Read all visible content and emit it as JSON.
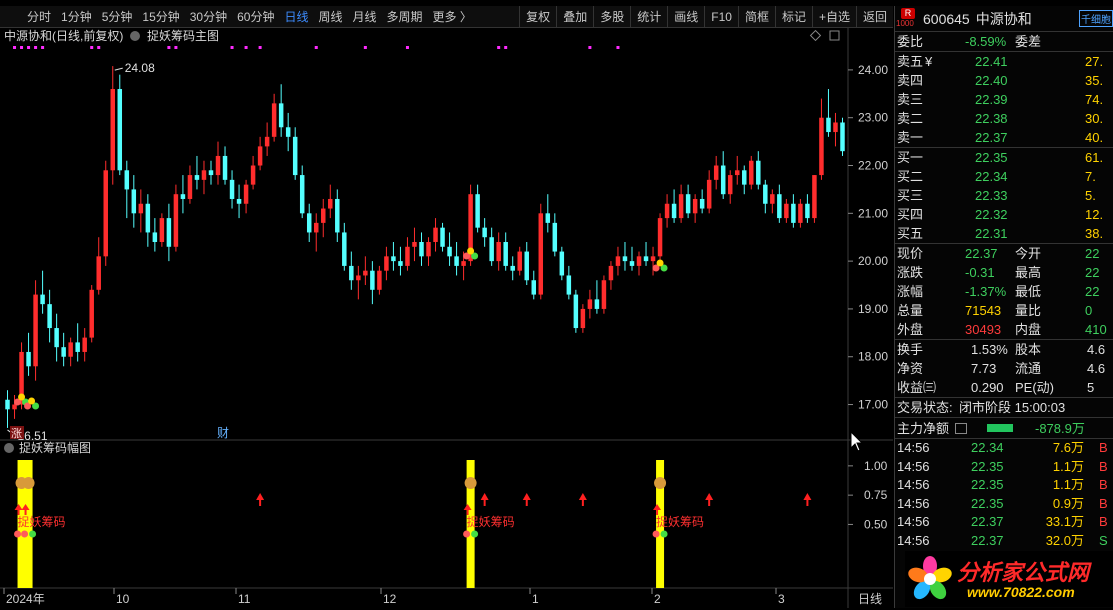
{
  "toolbar": {
    "periods": [
      "分时",
      "1分钟",
      "5分钟",
      "15分钟",
      "30分钟",
      "60分钟",
      "日线",
      "周线",
      "月线",
      "多周期",
      "更多 〉"
    ],
    "active_period": "日线",
    "right_buttons": [
      "复权",
      "叠加",
      "多股",
      "统计",
      "画线",
      "F10",
      "简框",
      "标记",
      "+自选",
      "返回"
    ]
  },
  "main_chart": {
    "title": "中源协和(日线,前复权)",
    "indicator": "捉妖筹码主图",
    "high_label": "24.08",
    "low_label": "16.51",
    "y_ticks": [
      "24.00",
      "23.00",
      "22.00",
      "21.00",
      "20.00",
      "19.00",
      "18.00",
      "17.00"
    ],
    "zhang_badge": "涨",
    "cai_badge": "财"
  },
  "sub_chart": {
    "title": "捉妖筹码幅图",
    "y_ticks": [
      "1.00",
      "0.75",
      "0.50"
    ],
    "signal_label": "捉妖筹码"
  },
  "x_axis": {
    "labels": [
      "2024年",
      "10",
      "11",
      "12",
      "1",
      "2",
      "3"
    ],
    "period_label": "日线"
  },
  "chart_data": {
    "type": "candlestick",
    "title": "中源协和(日线,前复权)",
    "ylim": [
      16.3,
      24.5
    ],
    "candles": [
      [
        17.1,
        17.3,
        16.51,
        16.9
      ],
      [
        16.9,
        17.2,
        16.7,
        17.0
      ],
      [
        17.0,
        18.3,
        16.9,
        18.1
      ],
      [
        18.1,
        18.5,
        17.6,
        17.8
      ],
      [
        17.8,
        19.6,
        17.5,
        19.3
      ],
      [
        19.3,
        19.8,
        18.9,
        19.1
      ],
      [
        19.1,
        19.4,
        18.3,
        18.6
      ],
      [
        18.6,
        18.9,
        17.9,
        18.2
      ],
      [
        18.2,
        18.5,
        17.8,
        18.0
      ],
      [
        18.0,
        18.4,
        17.8,
        18.3
      ],
      [
        18.3,
        18.7,
        17.9,
        18.1
      ],
      [
        18.1,
        18.6,
        17.9,
        18.4
      ],
      [
        18.4,
        19.5,
        18.3,
        19.4
      ],
      [
        19.4,
        20.5,
        19.3,
        20.1
      ],
      [
        20.1,
        22.1,
        19.9,
        21.9
      ],
      [
        21.9,
        24.08,
        21.6,
        23.6
      ],
      [
        23.6,
        23.9,
        21.8,
        21.9
      ],
      [
        21.9,
        22.1,
        20.9,
        21.5
      ],
      [
        21.5,
        21.8,
        20.7,
        21.0
      ],
      [
        21.0,
        21.5,
        20.6,
        21.2
      ],
      [
        21.2,
        21.4,
        20.3,
        20.6
      ],
      [
        20.6,
        20.9,
        20.2,
        20.4
      ],
      [
        20.4,
        21.0,
        20.3,
        20.9
      ],
      [
        20.9,
        21.2,
        20.0,
        20.3
      ],
      [
        20.3,
        21.6,
        20.2,
        21.4
      ],
      [
        21.4,
        21.8,
        21.0,
        21.3
      ],
      [
        21.3,
        22.0,
        21.2,
        21.8
      ],
      [
        21.8,
        22.2,
        21.5,
        21.7
      ],
      [
        21.7,
        22.1,
        21.4,
        21.9
      ],
      [
        21.9,
        22.1,
        21.6,
        21.8
      ],
      [
        21.8,
        22.5,
        21.6,
        22.2
      ],
      [
        22.2,
        22.4,
        21.6,
        21.7
      ],
      [
        21.7,
        21.9,
        21.1,
        21.3
      ],
      [
        21.3,
        21.6,
        20.9,
        21.2
      ],
      [
        21.2,
        21.7,
        21.0,
        21.6
      ],
      [
        21.6,
        22.2,
        21.5,
        22.0
      ],
      [
        22.0,
        22.6,
        21.9,
        22.4
      ],
      [
        22.4,
        22.9,
        22.2,
        22.6
      ],
      [
        22.6,
        23.5,
        22.5,
        23.3
      ],
      [
        23.3,
        23.7,
        22.6,
        22.8
      ],
      [
        22.8,
        23.1,
        22.3,
        22.6
      ],
      [
        22.6,
        22.8,
        21.7,
        21.8
      ],
      [
        21.8,
        22.0,
        20.9,
        21.0
      ],
      [
        21.0,
        21.2,
        20.4,
        20.6
      ],
      [
        20.6,
        21.0,
        20.2,
        20.8
      ],
      [
        20.8,
        21.3,
        20.5,
        21.1
      ],
      [
        21.1,
        21.6,
        20.9,
        21.3
      ],
      [
        21.3,
        21.5,
        20.4,
        20.6
      ],
      [
        20.6,
        20.8,
        19.8,
        19.9
      ],
      [
        19.9,
        20.2,
        19.4,
        19.6
      ],
      [
        19.6,
        19.9,
        19.2,
        19.7
      ],
      [
        19.7,
        20.1,
        19.5,
        19.8
      ],
      [
        19.8,
        20.0,
        19.1,
        19.4
      ],
      [
        19.4,
        19.9,
        19.3,
        19.8
      ],
      [
        19.8,
        20.3,
        19.6,
        20.1
      ],
      [
        20.1,
        20.4,
        19.8,
        20.0
      ],
      [
        20.0,
        20.3,
        19.7,
        19.9
      ],
      [
        19.9,
        20.5,
        19.8,
        20.3
      ],
      [
        20.3,
        20.7,
        20.0,
        20.4
      ],
      [
        20.4,
        20.6,
        19.9,
        20.1
      ],
      [
        20.1,
        20.5,
        19.9,
        20.4
      ],
      [
        20.4,
        20.9,
        20.2,
        20.7
      ],
      [
        20.7,
        20.8,
        20.2,
        20.3
      ],
      [
        20.3,
        20.6,
        19.9,
        20.1
      ],
      [
        20.1,
        20.4,
        19.7,
        19.9
      ],
      [
        19.9,
        20.2,
        19.6,
        20.0
      ],
      [
        20.0,
        21.6,
        19.9,
        21.4
      ],
      [
        21.4,
        21.6,
        20.6,
        20.7
      ],
      [
        20.7,
        20.9,
        20.3,
        20.5
      ],
      [
        20.5,
        20.7,
        19.9,
        20.0
      ],
      [
        20.0,
        20.6,
        19.8,
        20.4
      ],
      [
        20.4,
        20.6,
        19.8,
        19.9
      ],
      [
        19.9,
        20.1,
        19.6,
        19.8
      ],
      [
        19.8,
        20.3,
        19.7,
        20.2
      ],
      [
        20.2,
        20.4,
        19.5,
        19.6
      ],
      [
        19.6,
        19.8,
        19.2,
        19.3
      ],
      [
        19.3,
        21.2,
        19.2,
        21.0
      ],
      [
        21.0,
        21.4,
        20.6,
        20.8
      ],
      [
        20.8,
        21.0,
        20.1,
        20.2
      ],
      [
        20.2,
        20.3,
        19.6,
        19.7
      ],
      [
        19.7,
        19.9,
        19.2,
        19.3
      ],
      [
        19.3,
        19.4,
        18.5,
        18.6
      ],
      [
        18.6,
        19.1,
        18.5,
        19.0
      ],
      [
        19.0,
        19.4,
        18.8,
        19.2
      ],
      [
        19.2,
        19.6,
        18.9,
        19.0
      ],
      [
        19.0,
        19.7,
        18.9,
        19.6
      ],
      [
        19.6,
        20.0,
        19.4,
        19.9
      ],
      [
        19.9,
        20.3,
        19.7,
        20.1
      ],
      [
        20.1,
        20.4,
        19.8,
        20.0
      ],
      [
        20.0,
        20.3,
        19.8,
        19.9
      ],
      [
        19.9,
        20.2,
        19.7,
        20.1
      ],
      [
        20.1,
        20.4,
        19.9,
        20.0
      ],
      [
        20.0,
        20.3,
        19.7,
        20.1
      ],
      [
        20.1,
        21.0,
        19.9,
        20.9
      ],
      [
        20.9,
        21.4,
        20.7,
        21.2
      ],
      [
        21.2,
        21.5,
        20.8,
        20.9
      ],
      [
        20.9,
        21.6,
        20.8,
        21.4
      ],
      [
        21.4,
        21.6,
        20.9,
        21.0
      ],
      [
        21.0,
        21.4,
        20.8,
        21.3
      ],
      [
        21.3,
        21.5,
        21.0,
        21.1
      ],
      [
        21.1,
        21.9,
        21.0,
        21.7
      ],
      [
        21.7,
        22.2,
        21.5,
        22.0
      ],
      [
        22.0,
        22.3,
        21.3,
        21.4
      ],
      [
        21.4,
        21.9,
        21.2,
        21.8
      ],
      [
        21.8,
        22.2,
        21.6,
        21.9
      ],
      [
        21.9,
        22.0,
        21.4,
        21.6
      ],
      [
        21.6,
        22.2,
        21.5,
        22.1
      ],
      [
        22.1,
        22.3,
        21.5,
        21.6
      ],
      [
        21.6,
        21.7,
        21.0,
        21.2
      ],
      [
        21.2,
        21.5,
        21.0,
        21.4
      ],
      [
        21.4,
        21.6,
        20.8,
        20.9
      ],
      [
        20.9,
        21.3,
        20.8,
        21.2
      ],
      [
        21.2,
        21.4,
        20.7,
        20.8
      ],
      [
        20.8,
        21.3,
        20.7,
        21.2
      ],
      [
        21.2,
        21.4,
        20.8,
        20.9
      ],
      [
        20.9,
        21.8,
        20.8,
        21.8
      ],
      [
        21.8,
        23.4,
        21.7,
        23.0
      ],
      [
        23.0,
        23.6,
        22.6,
        22.7
      ],
      [
        22.7,
        23.1,
        22.4,
        22.9
      ],
      [
        22.9,
        23.0,
        22.2,
        22.3
      ]
    ],
    "signal_indices": [
      2,
      3,
      66,
      93
    ],
    "arrow_indices": [
      36,
      68,
      74,
      82,
      100,
      114
    ]
  },
  "quote": {
    "code": "600645",
    "name": "中源协和",
    "badge": "R",
    "badge_sub": "1000",
    "extra": "千细胞",
    "weibi_label": "委比",
    "weibi": "-8.59%",
    "weicha_label": "委差",
    "sells": [
      {
        "label": "卖五",
        "mark": "¥",
        "price": "22.41",
        "vol": "27."
      },
      {
        "label": "卖四",
        "mark": "",
        "price": "22.40",
        "vol": "35."
      },
      {
        "label": "卖三",
        "mark": "",
        "price": "22.39",
        "vol": "74."
      },
      {
        "label": "卖二",
        "mark": "",
        "price": "22.38",
        "vol": "30."
      },
      {
        "label": "卖一",
        "mark": "",
        "price": "22.37",
        "vol": "40."
      }
    ],
    "buys": [
      {
        "label": "买一",
        "price": "22.35",
        "vol": "61."
      },
      {
        "label": "买二",
        "price": "22.34",
        "vol": "7."
      },
      {
        "label": "买三",
        "price": "22.33",
        "vol": "5."
      },
      {
        "label": "买四",
        "price": "22.32",
        "vol": "12."
      },
      {
        "label": "买五",
        "price": "22.31",
        "vol": "38."
      }
    ],
    "stats": [
      {
        "l1": "现价",
        "v1": "22.37",
        "c1": "g",
        "l2": "今开",
        "v2": "22"
      },
      {
        "l1": "涨跌",
        "v1": "-0.31",
        "c1": "g",
        "l2": "最高",
        "v2": "22"
      },
      {
        "l1": "涨幅",
        "v1": "-1.37%",
        "c1": "g",
        "l2": "最低",
        "v2": "22"
      },
      {
        "l1": "总量",
        "v1": "71543",
        "c1": "y",
        "l2": "量比",
        "v2": "0"
      },
      {
        "l1": "外盘",
        "v1": "30493",
        "c1": "r2",
        "l2": "内盘",
        "v2": "410"
      }
    ],
    "stats2": [
      {
        "l1": "换手",
        "v1": "1.53%",
        "l2": "股本",
        "v2": "4.6"
      },
      {
        "l1": "净资",
        "v1": "7.73",
        "l2": "流通",
        "v2": "4.6"
      },
      {
        "l1": "收益㈢",
        "v1": "0.290",
        "l2": "PE(动)",
        "v2": "5"
      }
    ],
    "status_label": "交易状态:",
    "status": "闭市阶段 15:00:03",
    "flow_label": "主力净额",
    "flow_value": "-878.9万",
    "trades": [
      {
        "time": "14:56",
        "price": "22.34",
        "vol": "7.6万",
        "side": "B"
      },
      {
        "time": "14:56",
        "price": "22.35",
        "vol": "1.1万",
        "side": "B"
      },
      {
        "time": "14:56",
        "price": "22.35",
        "vol": "1.1万",
        "side": "B"
      },
      {
        "time": "14:56",
        "price": "22.35",
        "vol": "0.9万",
        "side": "B"
      },
      {
        "time": "14:56",
        "price": "22.37",
        "vol": "33.1万",
        "side": "B"
      },
      {
        "time": "14:56",
        "price": "22.37",
        "vol": "32.0万",
        "side": "S"
      }
    ]
  },
  "watermark": {
    "cn": "分析家公式网",
    "url": "www.70822.com"
  }
}
